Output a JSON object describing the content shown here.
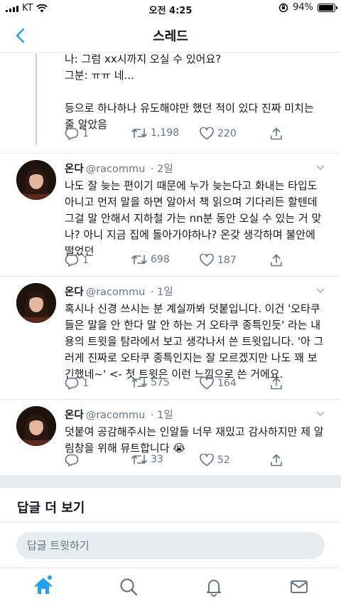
{
  "status_bar": {
    "carrier": "KT",
    "time": "오전 4:25",
    "battery_percent": "94%",
    "battery_level": 0.94
  },
  "nav": {
    "title": "스레드"
  },
  "colors": {
    "accent": "#1da1f2",
    "secondary_text": "#657786",
    "divider": "#e6ecf0"
  },
  "partial_tweet": {
    "lines": [
      "나: 그럼 xx시까지 오실 수 있어요?",
      "그분: ㅠㅠ 네...",
      "",
      "등으로 하나하나 유도해야만 했던 적이 있다 진짜 미치는",
      "줄 알았음"
    ],
    "replies": "1",
    "retweets": "1,198",
    "likes": "220"
  },
  "tweets": [
    {
      "name": "온다",
      "handle": "@racommu",
      "time": "2일",
      "lines": [
        "나도 잘 늦는 편이기 때문에 누가 늦는다고 화내는 타입도",
        "아니고 먼저 말을 하면 알아서 책 읽으며 기다리든 할텐데",
        "그걸 말 안해서 지하철 가는 nn분 동안 오실 수 있는 거 맞",
        "나? 아니 지금 집에 돌아가야하나? 온갖 생각하며 불안에",
        "떨었던"
      ],
      "replies": "1",
      "retweets": "698",
      "likes": "187"
    },
    {
      "name": "온다",
      "handle": "@racommu",
      "time": "1일",
      "lines": [
        "혹시나 신경 쓰시는 분 계실까봐 덧붙입니다. 이건 '오타쿠",
        "들은 말을 안 한다 말 안 하는 거 오타쿠 종특인듯' 라는 내",
        "용의 트윗을 탐라에서 보고 생각나서 쓴 트윗입니다. '아 그",
        "러게 진짜로 오타쿠 종특인지는 잘 모르겠지만 나도 꽤 보",
        "긴했네~' <- 첫 트윗은 이런 느낌으로 쓴 거에요."
      ],
      "replies": "1",
      "retweets": "575",
      "likes": "164"
    },
    {
      "name": "온다",
      "handle": "@racommu",
      "time": "1일",
      "lines": [
        "덧붙여 공감해주시는 인알들 너무 재밌고 감사하지만 제 알",
        "림창을 위해 뮤트합니다 😭"
      ],
      "replies": "",
      "retweets": "33",
      "likes": "52"
    }
  ],
  "more_replies": {
    "title": "답글 더 보기"
  },
  "composer": {
    "placeholder": "답글 트윗하기"
  },
  "tabs": [
    {
      "icon": "home-icon"
    },
    {
      "icon": "search-icon"
    },
    {
      "icon": "notifications-icon"
    },
    {
      "icon": "messages-icon"
    }
  ]
}
